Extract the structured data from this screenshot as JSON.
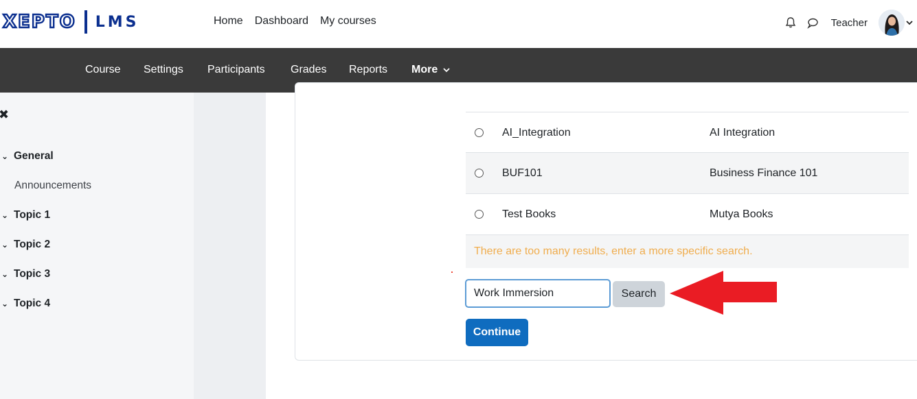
{
  "brand": {
    "name": "XEPTO",
    "product": "LMS",
    "color": "#0b2f8f"
  },
  "primary_nav": [
    "Home",
    "Dashboard",
    "My courses"
  ],
  "user": {
    "name": "Teacher",
    "icons": [
      "bell-icon",
      "chat-icon",
      "chevron-down-icon"
    ]
  },
  "secondary_nav": {
    "items": [
      "Course",
      "Settings",
      "Participants",
      "Grades",
      "Reports"
    ],
    "more": "More",
    "active": "More"
  },
  "drawer": {
    "close_icon": "close-icon",
    "sections": [
      {
        "label": "General",
        "expanded": true,
        "children": [
          "Announcements"
        ]
      },
      {
        "label": "Topic 1",
        "expanded": true,
        "children": []
      },
      {
        "label": "Topic 2",
        "expanded": true,
        "children": []
      },
      {
        "label": "Topic 3",
        "expanded": true,
        "children": []
      },
      {
        "label": "Topic 4",
        "expanded": true,
        "children": []
      }
    ]
  },
  "results": [
    {
      "shortname": "AI_Integration",
      "fullname": "AI Integration",
      "selected": false
    },
    {
      "shortname": "BUF101",
      "fullname": "Business Finance 101",
      "selected": false
    },
    {
      "shortname": "Test Books",
      "fullname": "Mutya Books",
      "selected": false
    }
  ],
  "warning": "There are too many results, enter a more specific search.",
  "search": {
    "value": "Work Immersion",
    "button": "Search"
  },
  "continue_label": "Continue",
  "colors": {
    "primary": "#0f6cbf",
    "warning": "#f0ad4e",
    "annotation_arrow": "#ea1c24",
    "navbar_dark": "#3a3a3a"
  }
}
